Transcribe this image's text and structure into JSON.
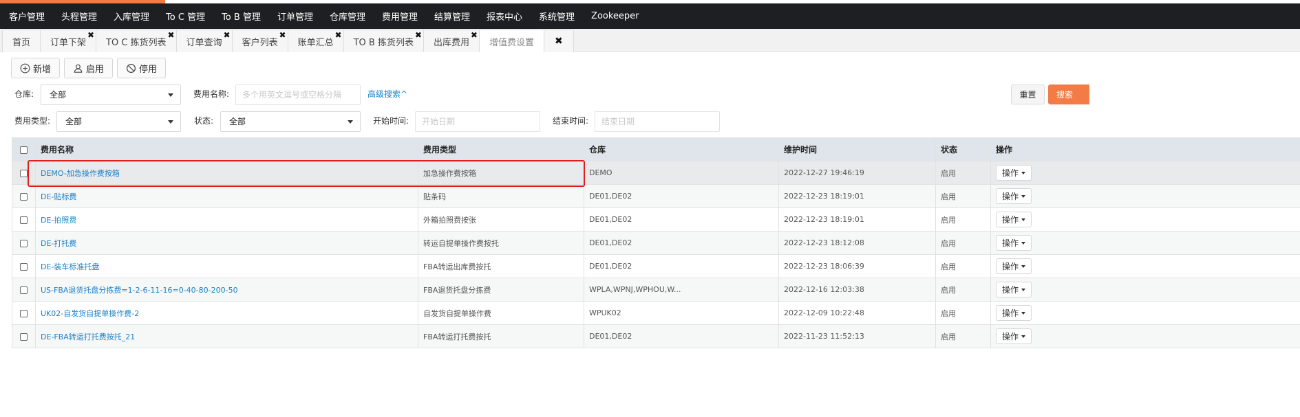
{
  "nav": [
    "客户管理",
    "头程管理",
    "入库管理",
    "To C 管理",
    "To B 管理",
    "订单管理",
    "仓库管理",
    "费用管理",
    "结算管理",
    "报表中心",
    "系统管理",
    "Zookeeper"
  ],
  "tabs": [
    {
      "label": "首页",
      "closable": false,
      "active": false
    },
    {
      "label": "订单下架",
      "closable": true,
      "active": false
    },
    {
      "label": "TO C 拣货列表",
      "closable": true,
      "active": false
    },
    {
      "label": "订单查询",
      "closable": true,
      "active": false
    },
    {
      "label": "客户列表",
      "closable": true,
      "active": false
    },
    {
      "label": "账单汇总",
      "closable": true,
      "active": false
    },
    {
      "label": "TO B 拣货列表",
      "closable": true,
      "active": false
    },
    {
      "label": "出库费用",
      "closable": true,
      "active": false
    },
    {
      "label": "增值费设置",
      "closable": false,
      "active": true
    }
  ],
  "tab_close_glyph": "✖",
  "toolbar": {
    "add": "新增",
    "enable": "启用",
    "disable": "停用"
  },
  "filters": {
    "warehouse_label": "仓库:",
    "warehouse_value": "全部",
    "fee_name_label": "费用名称:",
    "fee_name_placeholder": "多个用英文逗号或空格分隔",
    "advanced": "高级搜索^",
    "fee_type_label": "费用类型:",
    "fee_type_value": "全部",
    "status_label": "状态:",
    "status_value": "全部",
    "start_label": "开始时间:",
    "start_placeholder": "开始日期",
    "end_label": "结束时间:",
    "end_placeholder": "结束日期",
    "reset": "重置",
    "search": "搜索"
  },
  "table": {
    "headers": [
      "费用名称",
      "费用类型",
      "仓库",
      "维护时间",
      "状态",
      "操作"
    ],
    "action_label": "操作",
    "rows": [
      [
        "DEMO-加急操作费按箱",
        "加急操作费按箱",
        "DEMO",
        "2022-12-27 19:46:19",
        "启用"
      ],
      [
        "DE-贴标费",
        "贴条码",
        "DE01,DE02",
        "2022-12-23 18:19:01",
        "启用"
      ],
      [
        "DE-拍照费",
        "外箱拍照费按张",
        "DE01,DE02",
        "2022-12-23 18:19:01",
        "启用"
      ],
      [
        "DE-打托费",
        "转运自提单操作费按托",
        "DE01,DE02",
        "2022-12-23 18:12:08",
        "启用"
      ],
      [
        "DE-装车标准托盘",
        "FBA转运出库费按托",
        "DE01,DE02",
        "2022-12-23 18:06:39",
        "启用"
      ],
      [
        "US-FBA退货托盘分拣费=1-2-6-11-16=0-40-80-200-50",
        "FBA退货托盘分拣费",
        "WPLA,WPNJ,WPHOU,W...",
        "2022-12-16 12:03:38",
        "启用"
      ],
      [
        "UK02-自发货自提单操作费-2",
        "自发货自提单操作费",
        "WPUK02",
        "2022-12-09 10:22:48",
        "启用"
      ],
      [
        "DE-FBA转运打托费按托_21",
        "FBA转运打托费按托",
        "DE01,DE02",
        "2022-11-23 11:52:13",
        "启用"
      ]
    ]
  }
}
